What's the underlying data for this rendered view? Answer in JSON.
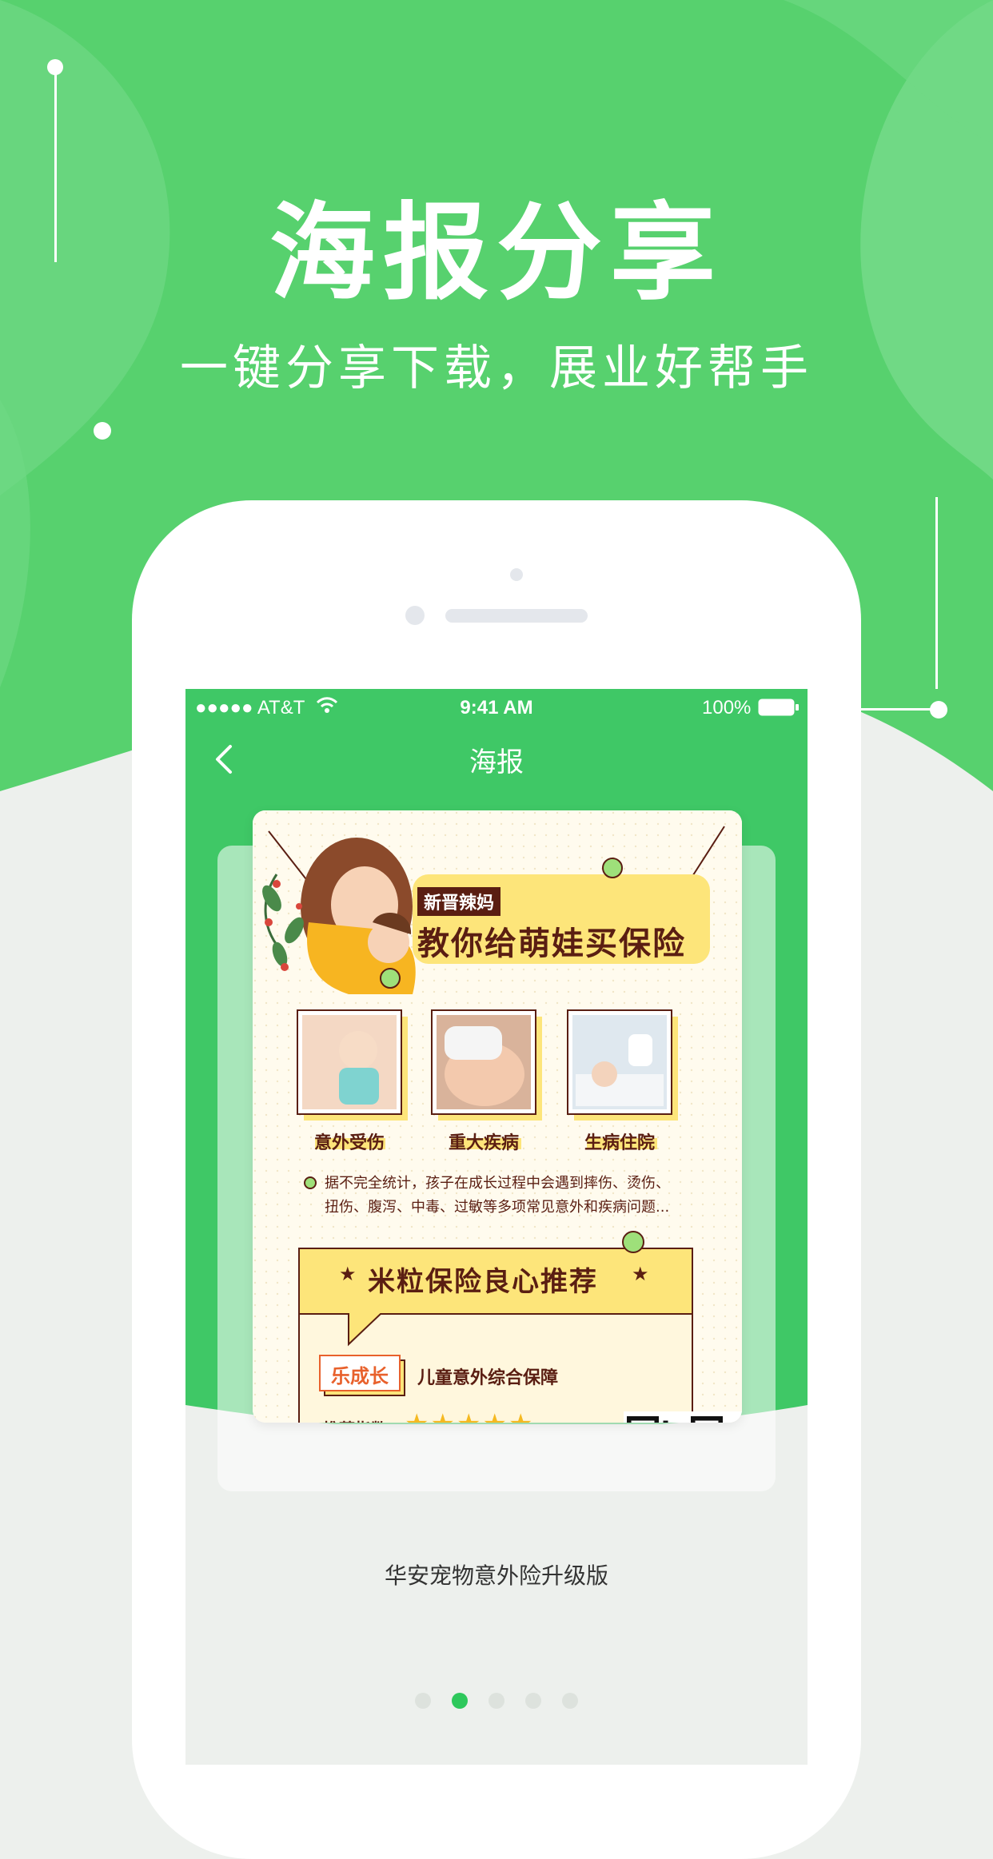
{
  "hero": {
    "title": "海报分享",
    "subtitle": "一键分享下载，展业好帮手"
  },
  "status_bar": {
    "carrier": "●●●●● AT&T",
    "time": "9:41 AM",
    "battery": "100%"
  },
  "nav": {
    "title": "海报",
    "back_icon": "chevron-left-icon"
  },
  "poster": {
    "tag": "新晋辣妈",
    "headline": "教你给萌娃买保险",
    "categories": [
      {
        "label": "意外受伤"
      },
      {
        "label": "重大疾病"
      },
      {
        "label": "生病住院"
      }
    ],
    "note_line1": "据不完全统计，孩子在成长过程中会遇到摔伤、烫伤、",
    "note_line2": "扭伤、腹泻、中毒、过敏等多项常见意外和疾病问题...",
    "recommend_title": "米粒保险良心推荐",
    "product_badge": "乐成长",
    "product_name": "儿童意外综合保障",
    "rating_label": "推荐指数:",
    "rating_stars": 5
  },
  "caption": "华安宠物意外险升级版",
  "pagination": {
    "total": 5,
    "active_index": 1
  },
  "colors": {
    "green": "#57d16e",
    "green_dark": "#3cc760",
    "poster_yellow": "#fde57a",
    "poster_brown": "#5a1e12",
    "dot_active": "#2ec85c"
  }
}
